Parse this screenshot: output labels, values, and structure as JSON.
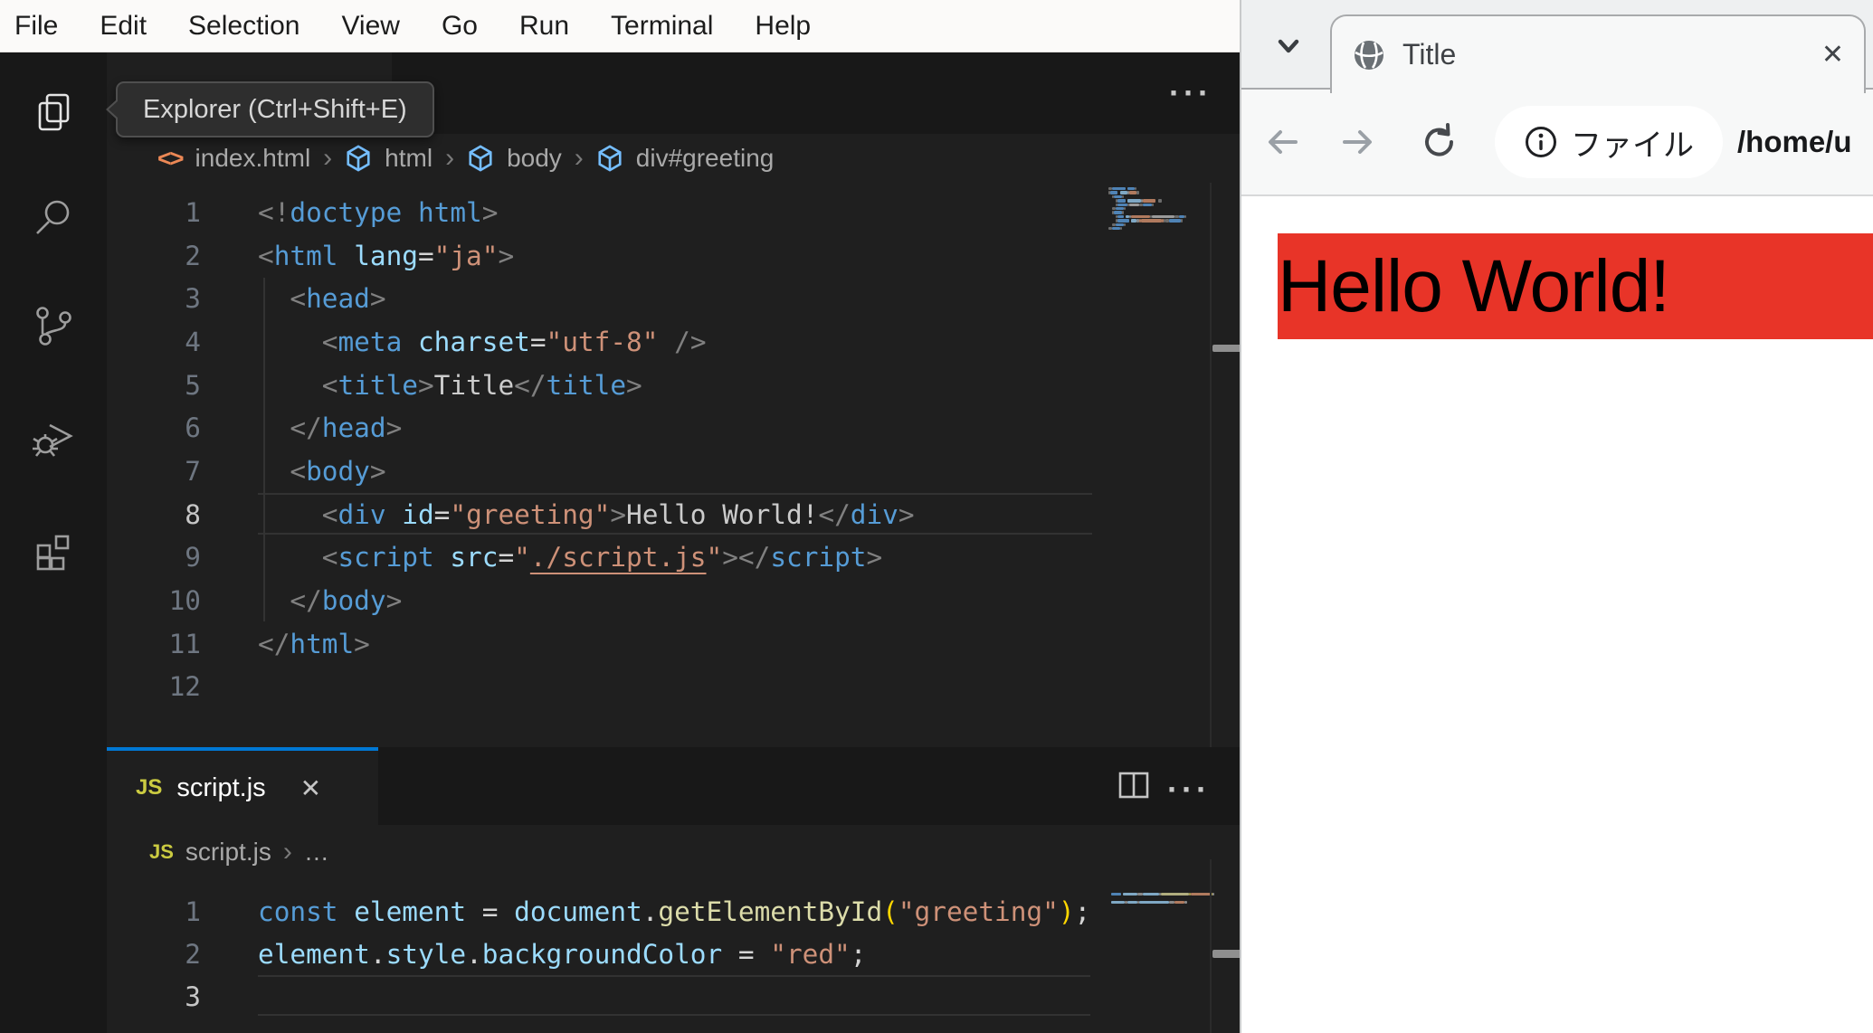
{
  "colors": {
    "accent_blue": "#0078d4",
    "editor_bg": "#1f1f1f",
    "activity_bg": "#181818",
    "menubar_bg": "#fbfaf9",
    "red_div": "#e83428",
    "browser_chrome": "#f7f8f8"
  },
  "vscode": {
    "menu": [
      "File",
      "Edit",
      "Selection",
      "View",
      "Go",
      "Run",
      "Terminal",
      "Help"
    ],
    "tooltip": "Explorer (Ctrl+Shift+E)",
    "activity_items": [
      "explorer",
      "search",
      "source-control",
      "run-and-debug",
      "extensions"
    ],
    "icons": {
      "ellipsis": "···",
      "close": "✕",
      "sep": "›",
      "more": "…"
    },
    "html_editor": {
      "tab": "index.html",
      "breadcrumbs": {
        "file": "index.html",
        "n1": "html",
        "n2": "body",
        "n3": "div#greeting"
      },
      "active_line": 8,
      "lines": [
        [
          [
            "p",
            "<!"
          ],
          [
            "tag",
            "doctype"
          ],
          [
            "pl",
            " "
          ],
          [
            "tag",
            "html"
          ],
          [
            "p",
            ">"
          ]
        ],
        [
          [
            "p",
            "<"
          ],
          [
            "tag",
            "html"
          ],
          [
            "pl",
            " "
          ],
          [
            "attr",
            "lang"
          ],
          [
            "op",
            "="
          ],
          [
            "str",
            "\"ja\""
          ],
          [
            "p",
            ">"
          ]
        ],
        [
          [
            "pl",
            "  "
          ],
          [
            "p",
            "<"
          ],
          [
            "tag",
            "head"
          ],
          [
            "p",
            ">"
          ]
        ],
        [
          [
            "pl",
            "    "
          ],
          [
            "p",
            "<"
          ],
          [
            "tag",
            "meta"
          ],
          [
            "pl",
            " "
          ],
          [
            "attr",
            "charset"
          ],
          [
            "op",
            "="
          ],
          [
            "str",
            "\"utf-8\""
          ],
          [
            "pl",
            " "
          ],
          [
            "p",
            "/>"
          ]
        ],
        [
          [
            "pl",
            "    "
          ],
          [
            "p",
            "<"
          ],
          [
            "tag",
            "title"
          ],
          [
            "p",
            ">"
          ],
          [
            "txt",
            "Title"
          ],
          [
            "p",
            "</"
          ],
          [
            "tag",
            "title"
          ],
          [
            "p",
            ">"
          ]
        ],
        [
          [
            "pl",
            "  "
          ],
          [
            "p",
            "</"
          ],
          [
            "tag",
            "head"
          ],
          [
            "p",
            ">"
          ]
        ],
        [
          [
            "pl",
            "  "
          ],
          [
            "p",
            "<"
          ],
          [
            "tag",
            "body"
          ],
          [
            "p",
            ">"
          ]
        ],
        [
          [
            "pl",
            "    "
          ],
          [
            "p",
            "<"
          ],
          [
            "tag",
            "div"
          ],
          [
            "pl",
            " "
          ],
          [
            "attr",
            "id"
          ],
          [
            "op",
            "="
          ],
          [
            "str",
            "\"greeting\""
          ],
          [
            "p",
            ">"
          ],
          [
            "txt",
            "Hello World!"
          ],
          [
            "p",
            "</"
          ],
          [
            "tag",
            "div"
          ],
          [
            "p",
            ">"
          ]
        ],
        [
          [
            "pl",
            "    "
          ],
          [
            "p",
            "<"
          ],
          [
            "tag",
            "script"
          ],
          [
            "pl",
            " "
          ],
          [
            "attr",
            "src"
          ],
          [
            "op",
            "="
          ],
          [
            "str",
            "\""
          ],
          [
            "lnk",
            "./script.js"
          ],
          [
            "str",
            "\""
          ],
          [
            "p",
            ">"
          ],
          [
            "p",
            "</"
          ],
          [
            "tag",
            "script"
          ],
          [
            "p",
            ">"
          ]
        ],
        [
          [
            "pl",
            "  "
          ],
          [
            "p",
            "</"
          ],
          [
            "tag",
            "body"
          ],
          [
            "p",
            ">"
          ]
        ],
        [
          [
            "p",
            "</"
          ],
          [
            "tag",
            "html"
          ],
          [
            "p",
            ">"
          ]
        ],
        []
      ]
    },
    "js_editor": {
      "tab": "script.js",
      "badge": "JS",
      "breadcrumbs": {
        "file": "script.js",
        "more": "…"
      },
      "active_line": 3,
      "lines": [
        [
          [
            "kw",
            "const"
          ],
          [
            "pl",
            " "
          ],
          [
            "v",
            "element"
          ],
          [
            "op",
            " = "
          ],
          [
            "v",
            "document"
          ],
          [
            "op",
            "."
          ],
          [
            "fn",
            "getElementById"
          ],
          [
            "au",
            "("
          ],
          [
            "str",
            "\"greeting\""
          ],
          [
            "au",
            ")"
          ],
          [
            "op",
            ";"
          ]
        ],
        [
          [
            "v",
            "element"
          ],
          [
            "op",
            "."
          ],
          [
            "v",
            "style"
          ],
          [
            "op",
            "."
          ],
          [
            "v",
            "backgroundColor"
          ],
          [
            "op",
            " = "
          ],
          [
            "str",
            "\"red\""
          ],
          [
            "op",
            ";"
          ]
        ],
        []
      ]
    }
  },
  "browser": {
    "tab": {
      "title": "Title",
      "close": "✕"
    },
    "toolbar": {
      "chip_label": "ファイル",
      "url": "/home/u"
    },
    "page": {
      "text": "Hello World!",
      "background": "#e83428"
    }
  }
}
